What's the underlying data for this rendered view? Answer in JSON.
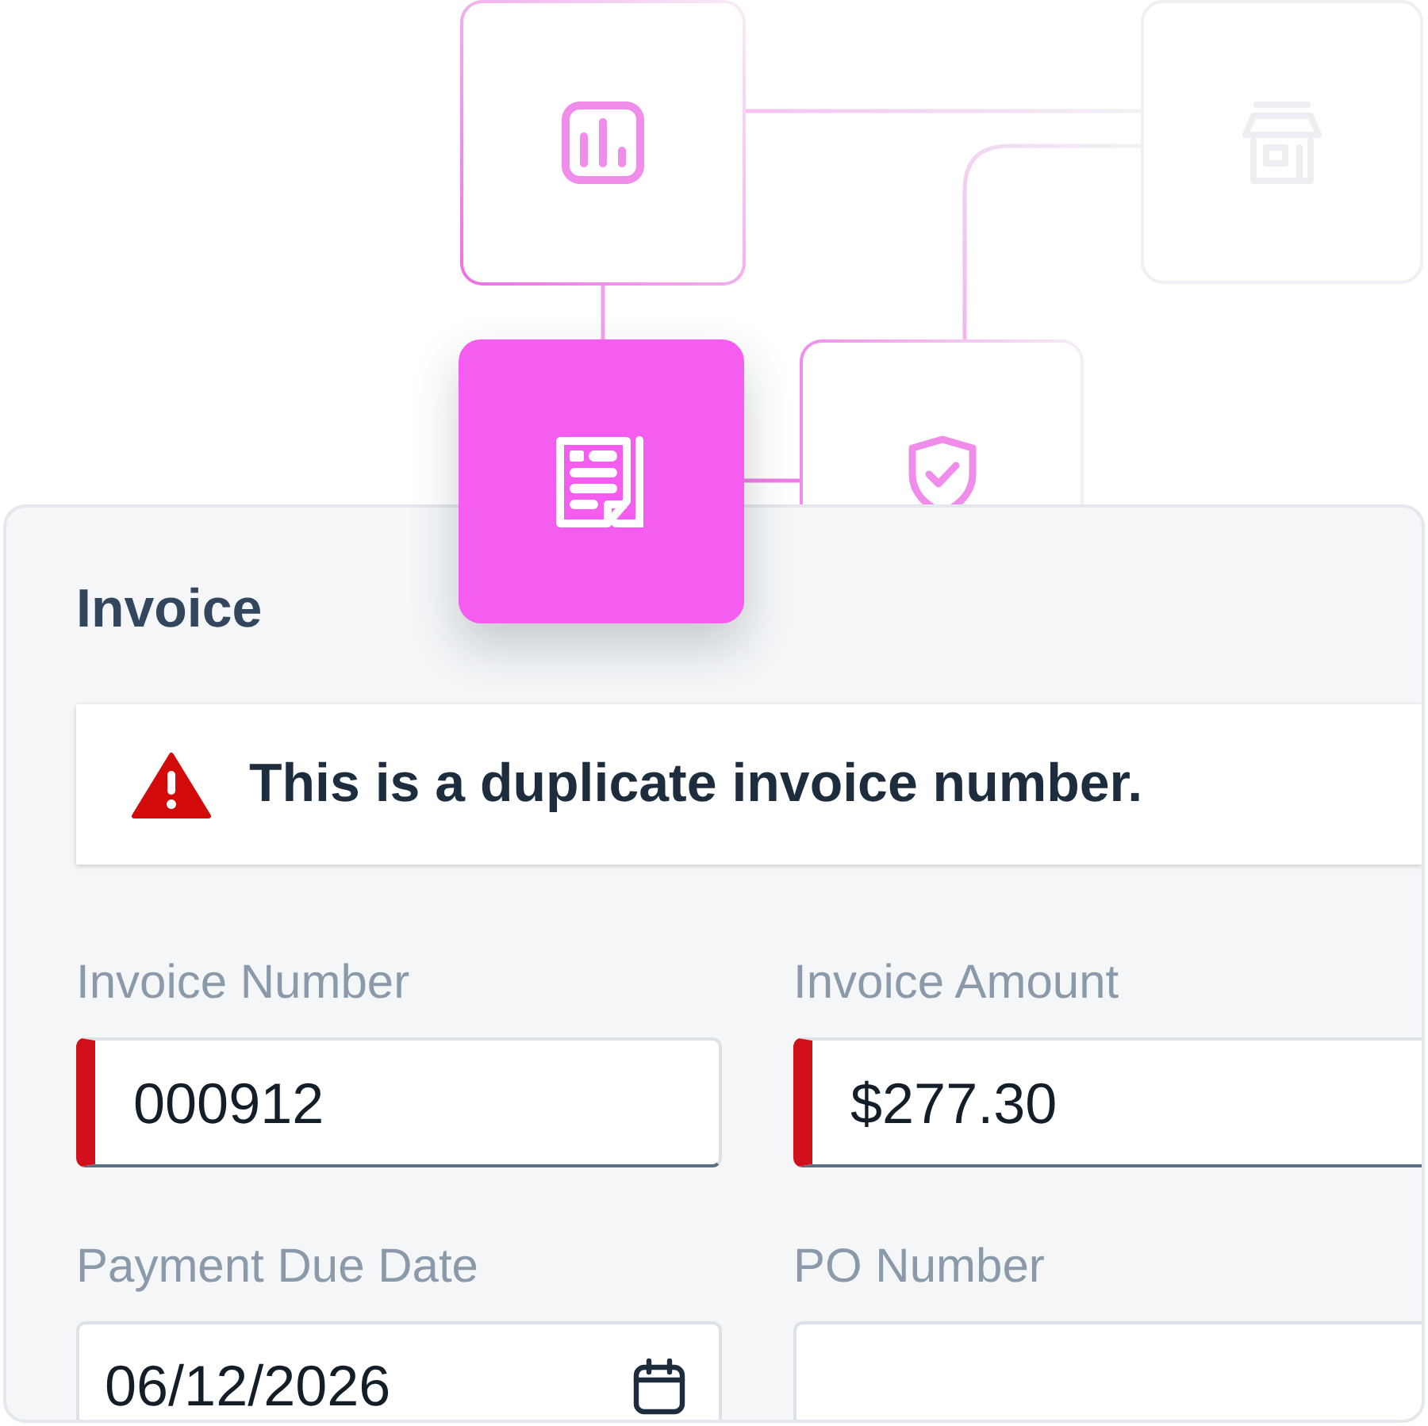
{
  "diagram": {
    "nodes": [
      {
        "kind": "chart",
        "selected": false,
        "disabled": false
      },
      {
        "kind": "store",
        "selected": false,
        "disabled": true
      },
      {
        "kind": "invoice",
        "selected": true,
        "disabled": false
      },
      {
        "kind": "shield",
        "selected": false,
        "disabled": false
      }
    ]
  },
  "form": {
    "title": "Invoice",
    "message": {
      "kind": "error",
      "text": "This is a duplicate invoice number."
    },
    "fields": [
      {
        "kind": "text",
        "label": "Invoice Number",
        "value": "000912",
        "error": true
      },
      {
        "kind": "text",
        "label": "Invoice Amount",
        "value": "$277.30",
        "error": true
      },
      {
        "kind": "date",
        "label": "Payment Due Date",
        "value": "06/12/2026",
        "error": false
      },
      {
        "kind": "text",
        "label": "PO Number",
        "error": false
      }
    ]
  }
}
